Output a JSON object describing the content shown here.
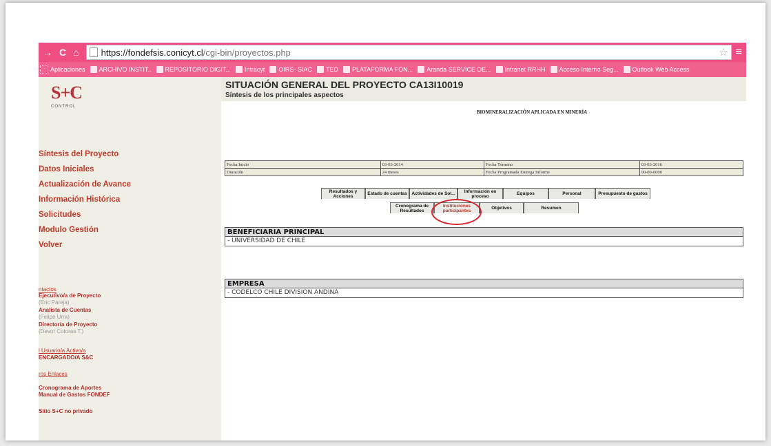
{
  "browser": {
    "url_host": "https://fondefsis.conicyt.cl",
    "url_path": "/cgi-bin/proyectos.php",
    "bookmarks": [
      "Aplicaciones",
      "ARCHIVO INSTIT..",
      "REPOSITORIO DIGIT...",
      "Intracyt",
      "OIRS- SIAC",
      "TED",
      "PLATAFORMA FON...",
      "Aranda SERVICE DE...",
      "Intranet RRHH",
      "Acceso Interno Seg...",
      "Outlook Web Access"
    ]
  },
  "logo": {
    "mark": "S+C",
    "sub": "CONTROL"
  },
  "sidebar": {
    "nav": [
      "Síntesis del Proyecto",
      "Datos Iniciales",
      "Actualización de Avance",
      "Información Histórica",
      "Solicitudes",
      "Modulo Gestión",
      "Volver"
    ],
    "contacts_header": "ntactos",
    "contacts": [
      {
        "role": "Ejecutivo/a de Proyecto",
        "name": "(Eric Pareja)"
      },
      {
        "role": "Analista de Cuentas",
        "name": "(Felipe Urra)"
      },
      {
        "role": "Directoría de Proyecto",
        "name": "(Devor Cotoras T.)"
      }
    ],
    "users_active": "l Usuario/a Activo/a",
    "user": "ENCARGADO/A S&C",
    "links_header": "ros Enlaces",
    "links": [
      "Cronograma de Aportes",
      "Manual de Gastos FONDEF"
    ],
    "site_link": "Sitio S+C no privado"
  },
  "main": {
    "title": "SITUACIÓN GENERAL DEL PROYECTO CA13I10019",
    "subtitle": "Síntesis de los principales aspectos",
    "project_name": "BIOMINERALIZACIÓN APLICADA EN MINERÍA",
    "info": {
      "start_label": "Fecha Inicio",
      "start_value": "03-03-2014",
      "end_label": "Fecha Término",
      "end_value": "03-03-2016",
      "duration_label": "Duración",
      "duration_value": "24 meses",
      "report_label": "Fecha Programada Entrega Informe",
      "report_value": "00-00-0000"
    },
    "tabs_row1": [
      "Resultados y Acciones",
      "Estado de cuentas",
      "Actividades de Sol...",
      "Información en proceso",
      "Equipos",
      "Personal",
      "Presupuesto de gastos"
    ],
    "tabs_row2": [
      "Cronograma de Resultados",
      "Instituciones participantes",
      "Objetivos",
      "Resumen"
    ],
    "beneficiaria_header": "BENEFICIARIA PRINCIPAL",
    "beneficiaria_value": "- UNIVERSIDAD DE CHILE",
    "empresa_header": "EMPRESA",
    "empresa_value": "- CODELCO CHILE DIVISION ANDINA"
  }
}
